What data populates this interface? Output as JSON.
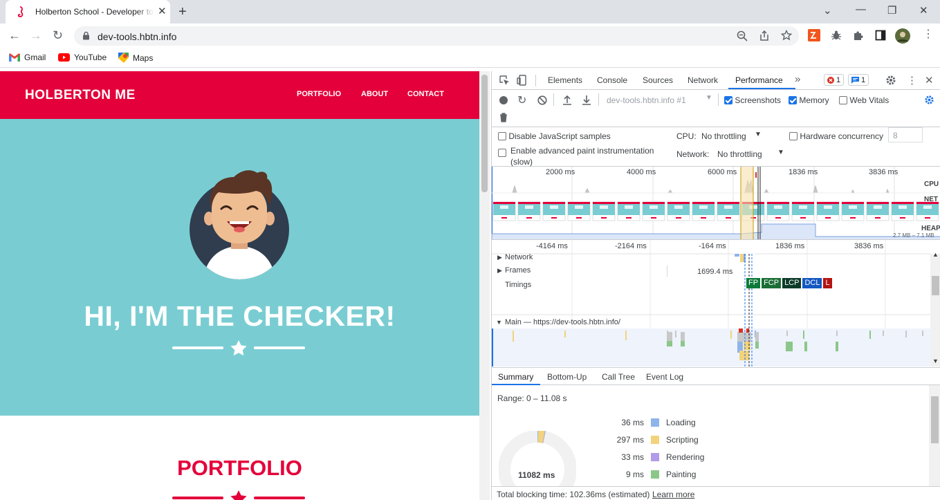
{
  "browser": {
    "tab_title": "Holberton School - Developer tools",
    "url": "dev-tools.hbtn.info",
    "bookmarks": [
      "Gmail",
      "YouTube",
      "Maps"
    ]
  },
  "site": {
    "brand": "HOLBERTON ME",
    "nav": [
      "PORTFOLIO",
      "ABOUT",
      "CONTACT"
    ],
    "hero_title": "HI, I'M THE CHECKER!",
    "section_title": "PORTFOLIO",
    "colors": {
      "primary": "#e4003a",
      "hero": "#79cdd2"
    }
  },
  "devtools": {
    "tabs": [
      "Elements",
      "Console",
      "Sources",
      "Network",
      "Performance"
    ],
    "active_tab": "Performance",
    "error_count": "1",
    "message_count": "1",
    "recording_select": "dev-tools.hbtn.info #1",
    "checkboxes": {
      "screenshots": "Screenshots",
      "memory": "Memory",
      "web_vitals": "Web Vitals"
    },
    "settings": {
      "disable_js": "Disable JavaScript samples",
      "adv_paint_1": "Enable advanced paint instrumentation",
      "adv_paint_2": "(slow)",
      "cpu_label": "CPU:",
      "cpu_value": "No throttling",
      "net_label": "Network:",
      "net_value": "No throttling",
      "hw_label": "Hardware concurrency",
      "hw_value": "8"
    },
    "overview": {
      "ticks": [
        "2000 ms",
        "4000 ms",
        "6000 ms",
        "1836 ms",
        "3836 ms"
      ],
      "labels": {
        "cpu": "CPU",
        "net": "NET",
        "heap": "HEAP"
      },
      "heap_range": "2.7 MB – 7.1 MB"
    },
    "tracks": {
      "ticks": [
        "-4164 ms",
        "-2164 ms",
        "-164 ms",
        "1836 ms",
        "3836 ms"
      ],
      "network": "Network",
      "frames": "Frames",
      "frame_time": "1699.4 ms",
      "timings": "Timings",
      "markers": [
        "FP",
        "FCP",
        "LCP",
        "DCL",
        "L"
      ],
      "main": "Main — https://dev-tools.hbtn.info/"
    },
    "bottom_tabs": [
      "Summary",
      "Bottom-Up",
      "Call Tree",
      "Event Log"
    ],
    "summary": {
      "range": "Range: 0 – 11.08 s",
      "total": "11082 ms",
      "rows": [
        {
          "value": "36 ms",
          "label": "Loading",
          "color": "#8fb4e9"
        },
        {
          "value": "297 ms",
          "label": "Scripting",
          "color": "#f2d37c"
        },
        {
          "value": "33 ms",
          "label": "Rendering",
          "color": "#b29be9"
        },
        {
          "value": "9 ms",
          "label": "Painting",
          "color": "#8cc78a"
        }
      ],
      "footer": "Total blocking time: 102.36ms (estimated)",
      "learn_more": "Learn more"
    }
  }
}
